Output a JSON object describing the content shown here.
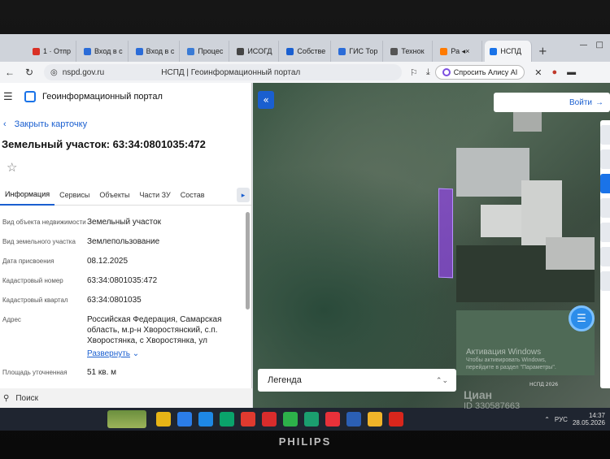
{
  "browser": {
    "tabs": [
      {
        "label": "1 · Отпр",
        "color": "#d93025"
      },
      {
        "label": "Вход в с",
        "color": "#2b6cd8"
      },
      {
        "label": "Вход в с",
        "color": "#2b6cd8"
      },
      {
        "label": "Процес",
        "color": "#3a7bd5"
      },
      {
        "label": "ИСОГД",
        "color": "#444444"
      },
      {
        "label": "Собстве",
        "color": "#1a5fd0"
      },
      {
        "label": "ГИС Тор",
        "color": "#2b6cd8"
      },
      {
        "label": "Технок",
        "color": "#555555"
      },
      {
        "label": "Ра ◂×",
        "color": "#ff7a00"
      },
      {
        "label": "НСПД",
        "color": "#1a73e8"
      }
    ],
    "url": "nspd.gov.ru",
    "page_title": "НСПД | Геоинформационный портал",
    "alice_label": "Спросить Алису AI"
  },
  "panel": {
    "portal_name": "Геоинформационный портал",
    "close_card": "Закрыть карточку",
    "title": "Земельный участок: 63:34:0801035:472",
    "tabs": [
      "Информация",
      "Сервисы",
      "Объекты",
      "Части ЗУ",
      "Состав"
    ],
    "rows": [
      {
        "label": "Вид объекта недвижимости",
        "value": "Земельный участок"
      },
      {
        "label": "Вид земельного участка",
        "value": "Землепользование"
      },
      {
        "label": "Дата присвоения",
        "value": "08.12.2025"
      },
      {
        "label": "Кадастровый номер",
        "value": "63:34:0801035:472"
      },
      {
        "label": "Кадастровый квартал",
        "value": "63:34:0801035"
      },
      {
        "label": "Адрес",
        "value": "Российская Федерация, Самарская область, м.р-н Хворостянский, с.п. Хворостянка, с Хворостянка, ул"
      },
      {
        "label": "Площадь уточненная",
        "value": "51 кв. м"
      }
    ],
    "expand_label": "Развернуть",
    "search_label": "Поиск"
  },
  "map": {
    "login_label": "Войти",
    "legend_label": "Легенда",
    "activation_title": "Активация Windows",
    "activation_text": "Чтобы активировать Windows, перейдите в раздел \"Параметры\".",
    "attribution": "НСПД 2026",
    "parcel_color": "#8c46dc"
  },
  "taskbar": {
    "lang": "РУС",
    "time": "14:37",
    "date": "28.05.2026",
    "apps": [
      "#e7b416",
      "#2b7de9",
      "#1e88e5",
      "#0aa36b",
      "#e03a2f",
      "#d92c2c",
      "#2db14a",
      "#1b9e6f",
      "#e8313a",
      "#2b5fb4",
      "#f0b429",
      "#d8261c"
    ]
  },
  "watermark": {
    "brand": "Циан",
    "id": "ID 330587663"
  },
  "monitor_brand": "PHILIPS"
}
